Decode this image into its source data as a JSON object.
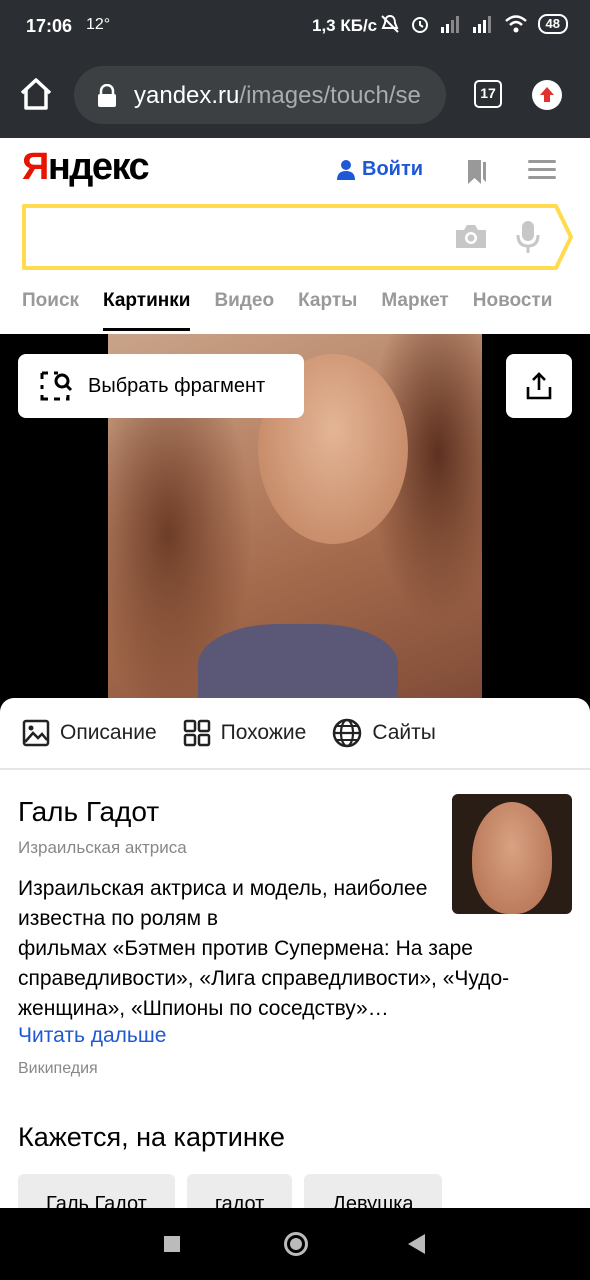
{
  "status_bar": {
    "time": "17:06",
    "temperature": "12°",
    "network_speed": "1,3 КБ/с",
    "battery": "48"
  },
  "browser": {
    "url_host": "yandex.ru",
    "url_path": "/images/touch/se",
    "tab_count": "17"
  },
  "yandex_header": {
    "logo_first": "Я",
    "logo_rest": "ндекс",
    "login_label": "Войти",
    "search_value": "",
    "services": [
      "Поиск",
      "Картинки",
      "Видео",
      "Карты",
      "Маркет",
      "Новости"
    ],
    "active_service": "Картинки"
  },
  "viewer": {
    "select_fragment_label": "Выбрать фрагмент"
  },
  "info_panel": {
    "tabs": {
      "description": "Описание",
      "similar": "Похожие",
      "sites": "Сайты"
    },
    "entity": {
      "title": "Галь Гадот",
      "subtitle": "Израильская актриса",
      "description_narrow": "Израильская актриса и модель, наиболее известна по ролям в",
      "description_wide": "фильмах «Бэтмен против Супермена: На заре справедливости», «Лига справедливости», «Чудо-женщина», «Шпионы по соседству»…",
      "read_more": "Читать дальше",
      "source": "Википедия"
    },
    "seems_title": "Кажется, на картинке",
    "chips": [
      "Галь Гадот",
      "гадот",
      "Девушка"
    ]
  },
  "colors": {
    "brand_red": "#e61400",
    "link_blue": "#1f58d6",
    "search_border_yellow": "#ffdb4d",
    "browser_chrome": "#2b2f33"
  }
}
